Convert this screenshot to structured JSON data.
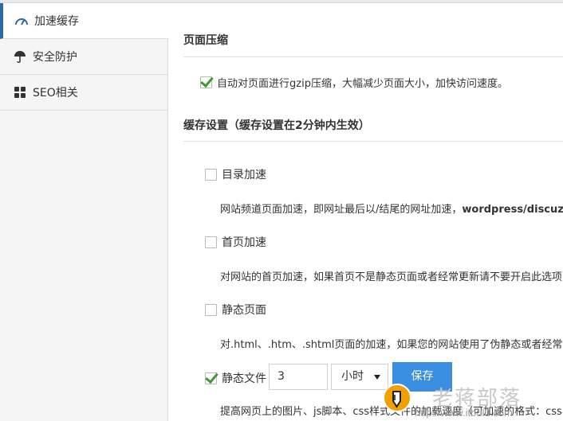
{
  "sidebar": {
    "items": [
      {
        "label": "加速缓存",
        "icon": "speedometer-icon"
      },
      {
        "label": "安全防护",
        "icon": "umbrella-icon"
      },
      {
        "label": "SEO相关",
        "icon": "grid-icon"
      }
    ],
    "accent": "#2b6aa8"
  },
  "compression": {
    "title": "页面压缩",
    "gzip_label": "自动对页面进行gzip压缩，大幅减少页面大小，加快访问速度。",
    "gzip_checked": true
  },
  "cache": {
    "title": "缓存设置（缓存设置在2分钟内生效）",
    "options": [
      {
        "label": "目录加速",
        "checked": false,
        "desc_pre": "网站频道页面加速，即网址最后以/结尾的网址加速，",
        "desc_bold": "wordpress/discuz请"
      },
      {
        "label": "首页加速",
        "checked": false,
        "desc_pre": "对网站的首页加速，如果首页不是静态页面或者经常更新请不要开启此选项",
        "desc_bold": ""
      },
      {
        "label": "静态页面",
        "checked": false,
        "desc_pre": "对.html、.htm、.shtml页面的加速，如果您的网站使用了伪静态或者经常更",
        "desc_bold": ""
      }
    ],
    "static_files": {
      "label": "静态文件",
      "checked": true,
      "duration_value": "3",
      "unit_selected": "小时",
      "save_label": "保存",
      "desc": "提高网页上的图片、js脚本、css样式文件的加载速度（可加速的格式：css、"
    }
  },
  "watermark": {
    "text": "老蒋部落",
    "url": "http://www.itbulu.com"
  },
  "colors": {
    "button": "#3a8fe0",
    "check": "#3c9a2e"
  }
}
